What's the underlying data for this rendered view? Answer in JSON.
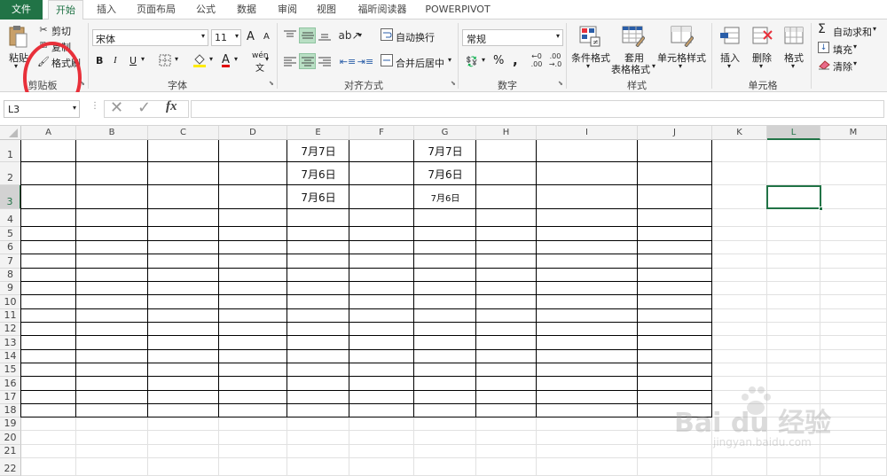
{
  "tabs": [
    "文件",
    "开始",
    "插入",
    "页面布局",
    "公式",
    "数据",
    "审阅",
    "视图",
    "福昕阅读器",
    "POWERPIVOT"
  ],
  "clipboard": {
    "paste": "粘贴",
    "cut": "剪切",
    "copy": "复制",
    "format_painter": "格式刷",
    "label": "剪贴板"
  },
  "font": {
    "name": "宋体",
    "size": "11",
    "label": "字体",
    "bold": "B",
    "italic": "I",
    "underline": "U",
    "grow": "A",
    "shrink": "A",
    "font_color": "A",
    "wen": "wén"
  },
  "align": {
    "wrap": "自动换行",
    "merge": "合并后居中",
    "label": "对齐方式"
  },
  "number": {
    "format": "常规",
    "percent": "%",
    "comma": ",",
    "label": "数字"
  },
  "styles": {
    "cond": "条件格式",
    "table1": "套用",
    "table2": "表格格式",
    "cell": "单元格样式",
    "label": "样式"
  },
  "cells": {
    "insert": "插入",
    "delete": "删除",
    "format": "格式",
    "label": "单元格"
  },
  "editing": {
    "autosum": "自动求和",
    "fill": "填充",
    "clear": "清除"
  },
  "namebox": "L3",
  "fx": "fx",
  "columns": [
    "A",
    "B",
    "C",
    "D",
    "E",
    "F",
    "G",
    "H",
    "I",
    "J",
    "K",
    "L",
    "M"
  ],
  "rows": [
    "1",
    "2",
    "3",
    "4",
    "5",
    "6",
    "7",
    "8",
    "9",
    "10",
    "11",
    "12",
    "13",
    "14",
    "15",
    "16",
    "17",
    "18",
    "19",
    "20",
    "21",
    "22"
  ],
  "cells_data": {
    "E1": "7月7日",
    "E2": "7月6日",
    "E3": "7月6日",
    "G1": "7月7日",
    "G2": "7月6日",
    "G3": "7月6日"
  },
  "watermark": {
    "brand": "Bai du 经验",
    "url": "jingyan.baidu.com"
  },
  "colors": {
    "accent": "#217346",
    "annotation": "#e8303a"
  }
}
